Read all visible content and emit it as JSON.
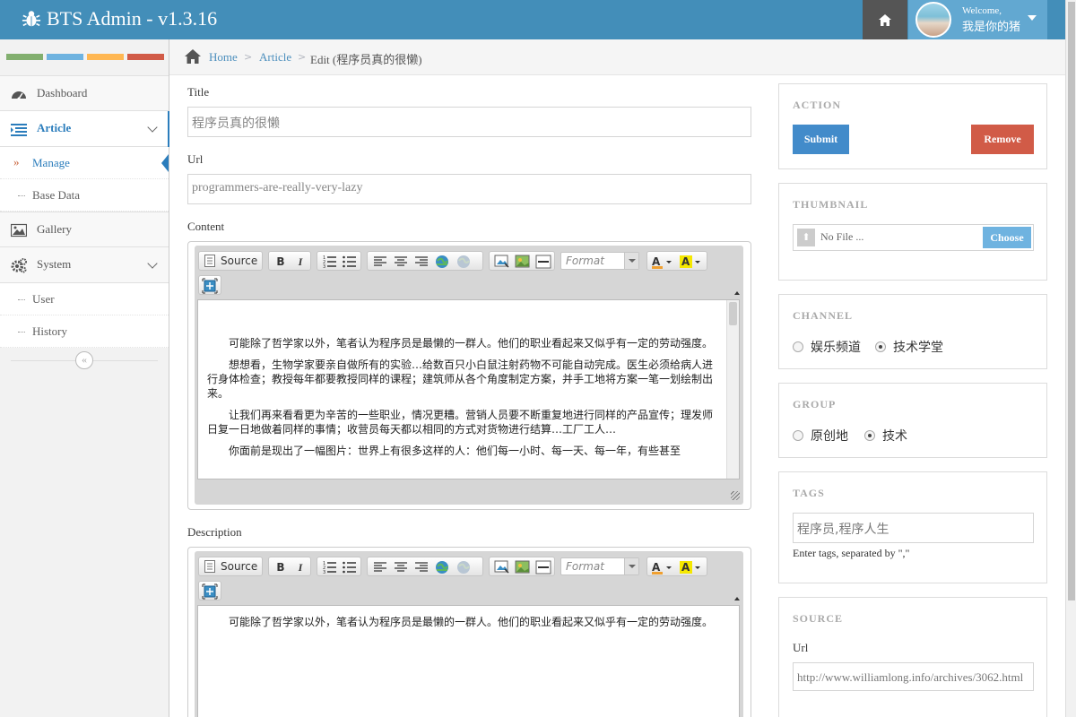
{
  "app": {
    "title": "BTS Admin - v1.3.16",
    "welcome_small": "Welcome,",
    "user_name": "我是你的猪"
  },
  "colors": {
    "navbar": "#438eb9",
    "accent": "#2b7dbc",
    "submit": "#428bca",
    "remove": "#d15b47",
    "color_bars": [
      "#82af6f",
      "#6fb3e0",
      "#ffb752",
      "#d15b47"
    ]
  },
  "sidebar": {
    "items": [
      {
        "label": "Dashboard",
        "icon": "dashboard-icon"
      },
      {
        "label": "Article",
        "icon": "list-icon"
      },
      {
        "label": "Gallery",
        "icon": "picture-icon"
      },
      {
        "label": "System",
        "icon": "cogs-icon"
      }
    ],
    "article_sub": [
      {
        "label": "Manage"
      },
      {
        "label": "Base Data"
      }
    ],
    "system_sub": [
      {
        "label": "User"
      },
      {
        "label": "History"
      }
    ],
    "collapse_glyph": "«"
  },
  "breadcrumb": {
    "home": "Home",
    "sep": ">",
    "article": "Article",
    "current": "Edit (程序员真的很懒)"
  },
  "form": {
    "title_label": "Title",
    "title_value": "程序员真的很懒",
    "url_label": "Url",
    "url_value": "programmers-are-really-very-lazy",
    "content_label": "Content",
    "description_label": "Description",
    "content_paragraphs": [
      "可能除了哲学家以外，笔者认为程序员是最懒的一群人。他们的职业看起来又似乎有一定的劳动强度。",
      "想想看，生物学家要亲自做所有的实验…给数百只小白鼠注射药物不可能自动完成。医生必须给病人进行身体检查；教授每年都要教授同样的课程；建筑师从各个角度制定方案，并手工地将方案一笔一划绘制出来。",
      "让我们再来看看更为辛苦的一些职业，情况更糟。营销人员要不断重复地进行同样的产品宣传；理发师日复一日地做着同样的事情；收营员每天都以相同的方式对货物进行结算…工厂工人…",
      "你面前是现出了一幅图片：世界上有很多这样的人：他们每一小时、每一天、每一年，有些甚至"
    ],
    "description_paragraphs": [
      "可能除了哲学家以外，笔者认为程序员是最懒的一群人。他们的职业看起来又似乎有一定的劳动强度。"
    ],
    "toolbar": {
      "source_label": "Source",
      "bold": "B",
      "italic": "I",
      "format_placeholder": "Format"
    }
  },
  "panels": {
    "action": {
      "title": "ACTION",
      "submit": "Submit",
      "remove": "Remove"
    },
    "thumbnail": {
      "title": "THUMBNAIL",
      "no_file": "No File ...",
      "choose": "Choose"
    },
    "channel": {
      "title": "CHANNEL",
      "options": [
        "娱乐频道",
        "技术学堂"
      ],
      "selected": "技术学堂"
    },
    "group": {
      "title": "GROUP",
      "options": [
        "原创地",
        "技术"
      ],
      "selected": "技术"
    },
    "tags": {
      "title": "TAGS",
      "value": "程序员,程序人生",
      "help": "Enter tags, separated by \",\""
    },
    "source": {
      "title": "SOURCE",
      "url_label": "Url",
      "url_value": "http://www.williamlong.info/archives/3062.html"
    }
  }
}
